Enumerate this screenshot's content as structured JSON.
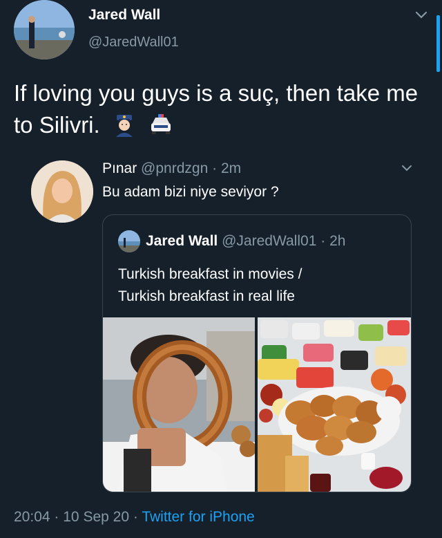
{
  "tweet": {
    "author_name": "Jared Wall",
    "author_handle": "@JaredWall01",
    "text": "If loving you guys is a suç, then take me to Silivri.",
    "emojis": [
      "police-officer-icon",
      "police-car-icon"
    ]
  },
  "reply": {
    "author_name": "Pınar",
    "author_handle": "@pnrdzgn",
    "sep": "·",
    "time": "2m",
    "text": "Bu adam bizi niye seviyor ?"
  },
  "quote": {
    "author_name": "Jared Wall",
    "author_handle": "@JaredWall01",
    "sep": "·",
    "time": "2h",
    "line1": "Turkish breakfast in movies /",
    "line2": "Turkish breakfast in real life"
  },
  "footer": {
    "time": "20:04",
    "sep1": "·",
    "date": "10 Sep 20",
    "sep2": "·",
    "source": "Twitter for iPhone"
  },
  "colors": {
    "background": "#15202b",
    "secondary_text": "#8899a6",
    "accent": "#1da1f2",
    "border": "#38444d"
  }
}
